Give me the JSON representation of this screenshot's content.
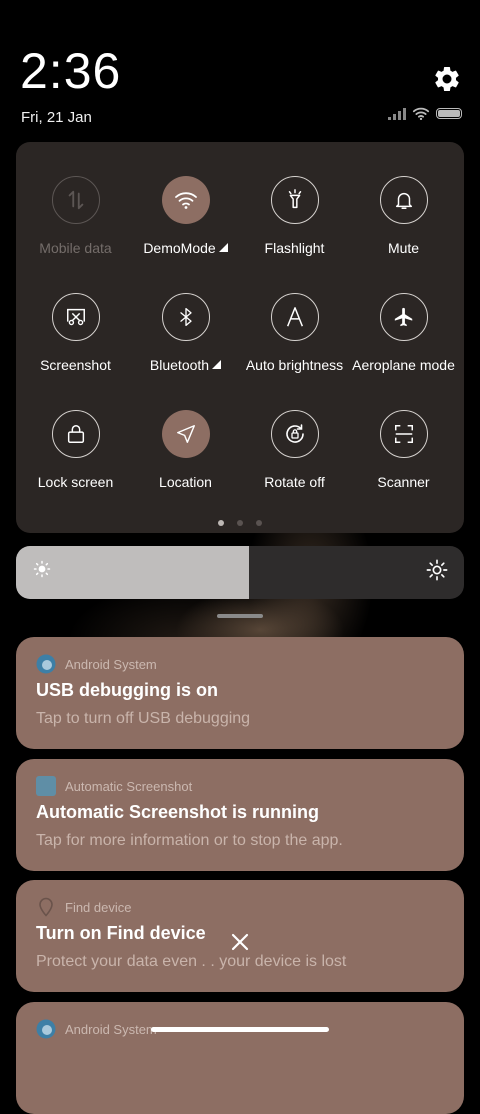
{
  "clock": {
    "time": "2:36",
    "date": "Fri, 21 Jan"
  },
  "status_icons": [
    "signal-icon",
    "wifi-icon",
    "battery-icon"
  ],
  "quick_settings": {
    "tiles": [
      {
        "label": "Mobile data",
        "icon": "mobile-data-icon",
        "active": false,
        "disabled": true
      },
      {
        "label": "DemoMode",
        "icon": "wifi-icon",
        "active": true,
        "expandable": true
      },
      {
        "label": "Flashlight",
        "icon": "flashlight-icon",
        "active": false
      },
      {
        "label": "Mute",
        "icon": "bell-icon",
        "active": false
      },
      {
        "label": "Screenshot",
        "icon": "screenshot-icon",
        "active": false
      },
      {
        "label": "Bluetooth",
        "icon": "bluetooth-icon",
        "active": false,
        "expandable": true
      },
      {
        "label": "Auto brightness",
        "icon": "auto-brightness-icon",
        "active": false
      },
      {
        "label": "Aeroplane mode",
        "icon": "airplane-icon",
        "active": false
      },
      {
        "label": "Lock screen",
        "icon": "lock-icon",
        "active": false
      },
      {
        "label": "Location",
        "icon": "location-icon",
        "active": true
      },
      {
        "label": "Rotate off",
        "icon": "rotate-lock-icon",
        "active": false
      },
      {
        "label": "Scanner",
        "icon": "scanner-icon",
        "active": false
      }
    ],
    "pages": 3,
    "current_page": 1
  },
  "brightness": {
    "level": 0.52
  },
  "notifications": [
    {
      "app": "Android System",
      "title": "USB debugging is on",
      "text": "Tap to turn off USB debugging"
    },
    {
      "app": "Automatic Screenshot",
      "title": "Automatic Screenshot is running",
      "text": "Tap for more information or to stop the app."
    },
    {
      "app": "Find device",
      "title": "Turn on Find device",
      "text": "Protect your data even .        . your device is lost"
    },
    {
      "app": "Android System"
    }
  ],
  "colors": {
    "accent": "#8d6e63",
    "panel": "#2b2624",
    "notification": "#8d6e63"
  }
}
